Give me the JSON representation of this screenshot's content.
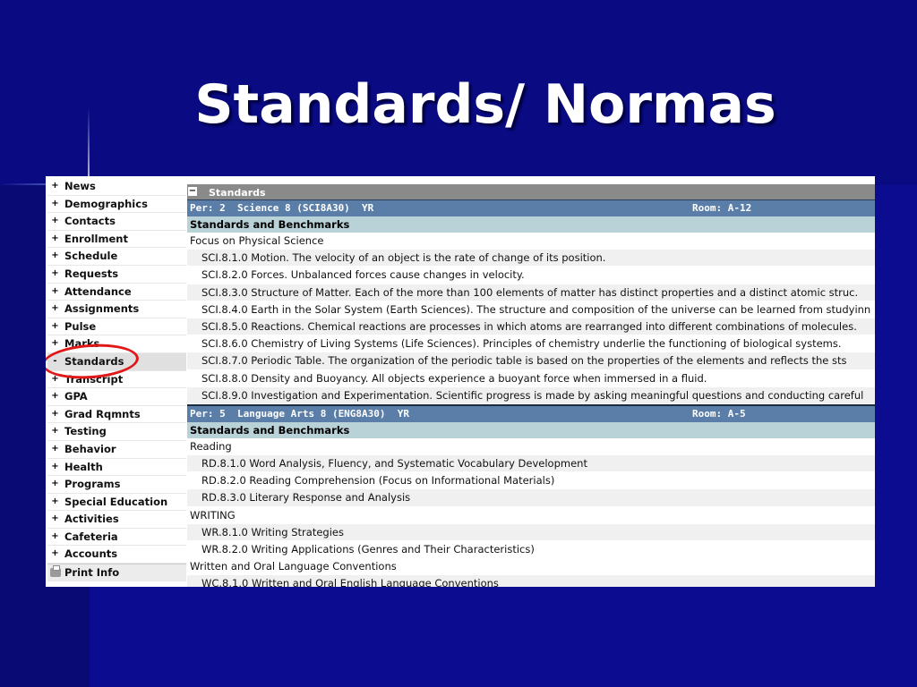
{
  "slide": {
    "title": "Standards/ Normas"
  },
  "nav": {
    "items": [
      {
        "label": "News"
      },
      {
        "label": "Demographics"
      },
      {
        "label": "Contacts"
      },
      {
        "label": "Enrollment"
      },
      {
        "label": "Schedule"
      },
      {
        "label": "Requests"
      },
      {
        "label": "Attendance"
      },
      {
        "label": "Assignments"
      },
      {
        "label": "Pulse"
      },
      {
        "label": "Marks"
      },
      {
        "label": "Standards"
      },
      {
        "label": "Transcript"
      },
      {
        "label": "GPA"
      },
      {
        "label": "Grad Rqmnts"
      },
      {
        "label": "Testing"
      },
      {
        "label": "Behavior"
      },
      {
        "label": "Health"
      },
      {
        "label": "Programs"
      },
      {
        "label": "Special Education"
      },
      {
        "label": "Activities"
      },
      {
        "label": "Cafeteria"
      },
      {
        "label": "Accounts"
      }
    ],
    "print_label": "Print Info"
  },
  "content": {
    "header": "Standards",
    "courses": [
      {
        "period": "Per: 2  Science 8 (SCI8A30)  YR",
        "room": "Room: A-12",
        "subheader": "Standards and Benchmarks",
        "sections": [
          {
            "title": "Focus on Physical Science",
            "items": [
              "SCI.8.1.0 Motion. The velocity of an object is the rate of change of its position.",
              "SCI.8.2.0 Forces. Unbalanced forces cause changes in velocity.",
              "SCI.8.3.0 Structure of Matter. Each of the more than 100 elements of matter has distinct properties and a distinct atomic struc.",
              "SCI.8.4.0 Earth in the Solar System (Earth Sciences). The structure and composition of the universe can be learned from studyinn",
              "SCI.8.5.0 Reactions. Chemical reactions are processes in which atoms are rearranged into different combinations of molecules.",
              "SCI.8.6.0 Chemistry of Living Systems (Life Sciences). Principles of chemistry underlie the functioning of biological systems.",
              "SCI.8.7.0 Periodic Table. The organization of the periodic table is based on the properties of the elements and reflects the sts",
              "SCI.8.8.0 Density and Buoyancy. All objects experience a buoyant force when immersed in a fluid.",
              "SCI.8.9.0 Investigation and Experimentation. Scientific progress is made by asking meaningful questions and conducting careful"
            ]
          }
        ]
      },
      {
        "period": "Per: 5  Language Arts 8 (ENG8A30)  YR",
        "room": "Room: A-5",
        "subheader": "Standards and Benchmarks",
        "sections": [
          {
            "title": "Reading",
            "items": [
              "RD.8.1.0 Word Analysis, Fluency, and Systematic Vocabulary Development",
              "RD.8.2.0 Reading Comprehension (Focus on Informational Materials)",
              "RD.8.3.0 Literary Response and Analysis"
            ]
          },
          {
            "title": "WRITING",
            "items": [
              "WR.8.1.0 Writing Strategies",
              "WR.8.2.0 Writing Applications (Genres and Their Characteristics)"
            ]
          },
          {
            "title": "Written and Oral Language Conventions",
            "items": [
              "WC.8.1.0 Written and Oral English Language Conventions"
            ]
          }
        ]
      }
    ]
  }
}
